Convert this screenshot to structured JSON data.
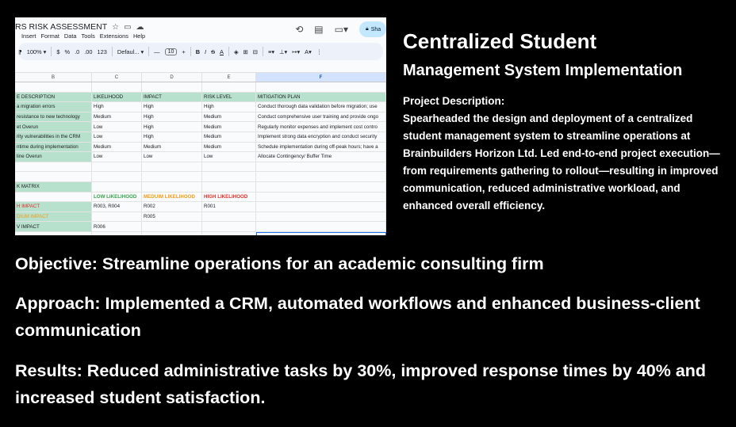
{
  "sheet": {
    "doc_title": "RS RISK ASSESSMENT",
    "menu": [
      "Insert",
      "Format",
      "Data",
      "Tools",
      "Extensions",
      "Help"
    ],
    "share_label": "Sha",
    "toolbar": {
      "zoom": "100%",
      "currency": "$",
      "percent": "%",
      "dec_dec": ".0",
      "dec_inc": ".00",
      "format_num": "123",
      "font": "Defaul...",
      "font_size": "10",
      "minus": "—",
      "plus": "+",
      "bold": "B",
      "italic": "I",
      "strike": "S",
      "text_color": "A"
    },
    "col_headers": [
      "B",
      "C",
      "D",
      "E",
      "F"
    ],
    "rows": [
      [
        "",
        "",
        "",
        "",
        ""
      ],
      [
        "E DESCRIPTION",
        "LIKELIHOOD",
        "IMPACT",
        "RISK LEVEL",
        "MITIGATION PLAN"
      ],
      [
        "a migration errors",
        "High",
        "High",
        "High",
        "Conduct thorough data validation before migration; use"
      ],
      [
        "resistance to new technology",
        "Medium",
        "High",
        "Medium",
        "Conduct comprehensive user training and provide ongo"
      ],
      [
        "et Overun",
        "Low",
        "High",
        "Medium",
        " Regularly monitor expenses and implement cost contro"
      ],
      [
        "rity vulnerabilities in the CRM",
        "Low",
        "High",
        "Medium",
        "Implement strong data encryption and conduct security"
      ],
      [
        "ntime during implementation",
        "Medium",
        "Medium",
        "Medium",
        "Schedule implementation during off-peak hours; have a"
      ],
      [
        "line Overun",
        "Low",
        "Low",
        "Low",
        "Allocate Contingency/ Buffer Time"
      ],
      [
        "",
        "",
        "",
        "",
        ""
      ],
      [
        "",
        "",
        "",
        "",
        ""
      ],
      [
        "K MATRIX",
        "",
        "",
        "",
        ""
      ],
      [
        "",
        "LOW LIKELIHOOD",
        "MEDUIM LIKELIHOOD",
        "HIGH LIKELIHOOD",
        ""
      ],
      [
        "H IMPACT",
        "R003, R004",
        "R002",
        "R001",
        ""
      ],
      [
        "DIUM IMPACT",
        "",
        "R005",
        "",
        ""
      ],
      [
        "V IMPACT",
        "R006",
        "",
        "",
        ""
      ],
      [
        "",
        "",
        "",
        "",
        ""
      ],
      [
        "",
        "",
        "",
        "",
        ""
      ]
    ]
  },
  "heading": {
    "title": "Centralized Student",
    "subtitle": "Management System Implementation"
  },
  "description": {
    "label": "Project Description:",
    "text": "Spearheaded the design and deployment of a centralized student management system to streamline operations at Brainbuilders Horizon Ltd. Led end-to-end project execution— from requirements gathering to rollout—resulting in improved communication, reduced administrative workload, and enhanced overall efficiency."
  },
  "bullets": {
    "objective": "Objective: Streamline operations for an academic consulting firm",
    "approach": "Approach: Implemented a CRM, automated workflows and enhanced business-client communication",
    "results": "Results: Reduced administrative tasks by 30%, improved response times by 40% and increased student satisfaction."
  }
}
